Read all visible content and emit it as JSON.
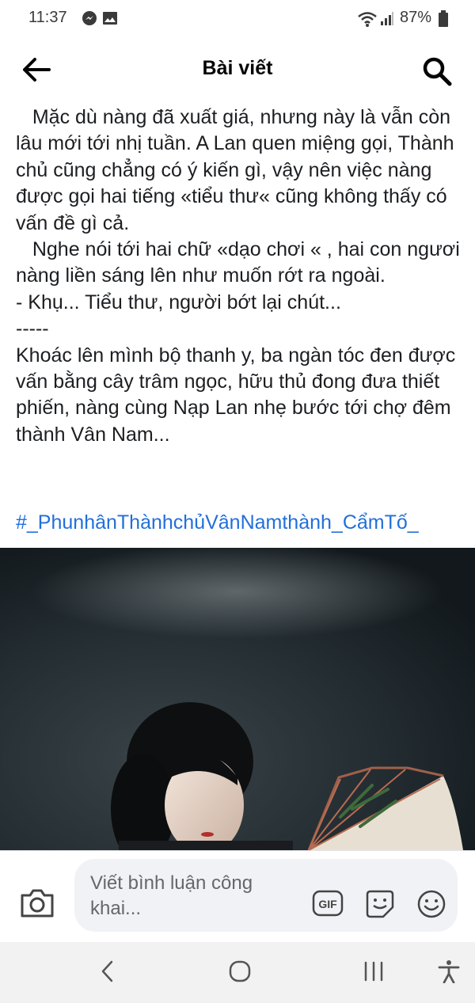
{
  "status_bar": {
    "time": "11:37",
    "battery": "87%",
    "icons": [
      "messenger-icon",
      "image-icon",
      "wifi-icon",
      "signal-icon",
      "battery-icon"
    ]
  },
  "header": {
    "title": "Bài viết",
    "back_icon": "arrow-left-icon",
    "search_icon": "search-icon"
  },
  "post": {
    "paragraphs": [
      "   Mặc dù nàng đã xuất giá, nhưng này là vẫn còn lâu mới tới nhị tuần. A Lan quen miệng gọi, Thành chủ cũng chẳng có ý kiến gì, vậy nên việc nàng được gọi hai tiếng «tiểu thư« cũng không thấy có vấn đề gì cả.",
      "   Nghe nói tới hai chữ «dạo chơi « , hai con ngươi nàng liền sáng lên như muốn rớt ra ngoài.",
      "- Khụ... Tiểu thư, người bớt lại chút...",
      "-----",
      "Khoác lên mình bộ thanh y, ba ngàn tóc đen được vấn bằng cây trâm ngọc, hữu thủ đong đưa thiết phiến, nàng cùng Nạp Lan nhẹ bước tới chợ đêm thành Vân Nam..."
    ],
    "hashtag": "#_PhunhânThànhchủVânNamthành_CẩmTố_"
  },
  "comment_bar": {
    "placeholder": "Viết bình luận công khai...",
    "gif_label": "GIF",
    "icons": [
      "camera-icon",
      "gif-icon",
      "sticker-icon",
      "emoji-icon"
    ]
  },
  "nav_bar": {
    "icons": [
      "back-nav-icon",
      "home-nav-icon",
      "recents-nav-icon",
      "accessibility-icon"
    ]
  },
  "colors": {
    "link": "#216fdb",
    "text": "#1c1e21",
    "placeholder": "#65676b",
    "input_bg": "#f0f2f5",
    "nav_bg": "#f2f2f2",
    "photo_bg": "#1d262b"
  }
}
